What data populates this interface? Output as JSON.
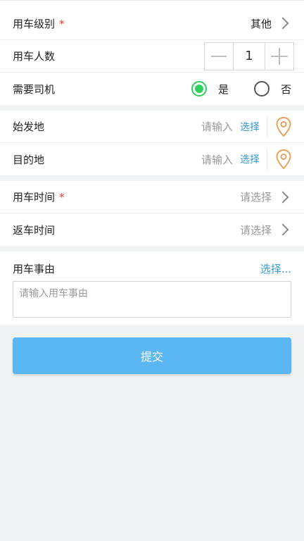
{
  "form": {
    "level": {
      "label": "用车级别",
      "required_mark": "*",
      "value": "其他"
    },
    "people": {
      "label": "用车人数",
      "count": "1"
    },
    "driver": {
      "label": "需要司机",
      "yes": "是",
      "no": "否",
      "selected": "yes"
    },
    "start": {
      "label": "始发地",
      "placeholder": "请输入",
      "select": "选择"
    },
    "dest": {
      "label": "目的地",
      "placeholder": "请输入",
      "select": "选择"
    },
    "use_time": {
      "label": "用车时间",
      "required_mark": "*",
      "placeholder": "请选择"
    },
    "return_time": {
      "label": "返车时间",
      "placeholder": "请选择"
    },
    "reason": {
      "label": "用车事由",
      "select": "选择...",
      "placeholder": "请输入用车事由"
    }
  },
  "submit_label": "提交",
  "colors": {
    "accent": "#5bb7f2",
    "link": "#3a9ad9",
    "required": "#e23b3b",
    "radio_on": "#2ed15f",
    "pin": "#e8a25a"
  },
  "icons": [
    "chevron-right-icon",
    "minus-icon",
    "plus-icon",
    "location-pin-icon"
  ]
}
